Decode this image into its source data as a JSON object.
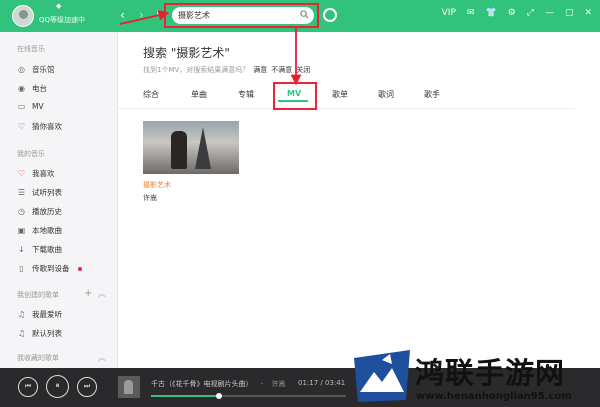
{
  "header": {
    "username": "QQ等级加速中",
    "search_value": "摄影艺术",
    "top_right": [
      "VIP",
      "✉",
      "👕",
      "⚙",
      "⤢",
      "—",
      "▢",
      "✕"
    ]
  },
  "sidebar": {
    "section_online": "在线音乐",
    "online_items": [
      "音乐馆",
      "电台",
      "MV",
      "猜你喜欢"
    ],
    "section_mine": "我的音乐",
    "mine_items": [
      "我喜欢",
      "试听列表",
      "播放历史",
      "本地歌曲",
      "下载歌曲",
      "传歌到设备"
    ],
    "section_created": "我创建的歌单",
    "created_items": [
      "我最爱听",
      "默认列表"
    ],
    "section_collected": "我收藏的歌单"
  },
  "main": {
    "title": "搜索 \"摄影艺术\"",
    "subtitle_prefix": "找到1个MV，对搜索结果满意吗？",
    "opt_yes": "满意",
    "opt_no": "不满意",
    "opt_close": "关闭",
    "tabs": [
      "综合",
      "单曲",
      "专辑",
      "MV",
      "歌单",
      "歌词",
      "歌手"
    ],
    "active_tab": "MV",
    "mv_results": [
      {
        "title": "摄影艺术",
        "artist": "许嵩"
      }
    ]
  },
  "player": {
    "song": "千古（《花千骨》电视剧片头曲）",
    "separator": "-",
    "artist": "许嵩",
    "time": "01:17 / 03:41",
    "progress": 0.35
  },
  "watermark": {
    "text": "鸿联手游网",
    "url": "www.henanhonglian95.com"
  },
  "colors": {
    "accent": "#31c27c",
    "highlight_box": "#e22233",
    "mv_title": "#f08030",
    "player_bg": "#2a2a2c"
  }
}
